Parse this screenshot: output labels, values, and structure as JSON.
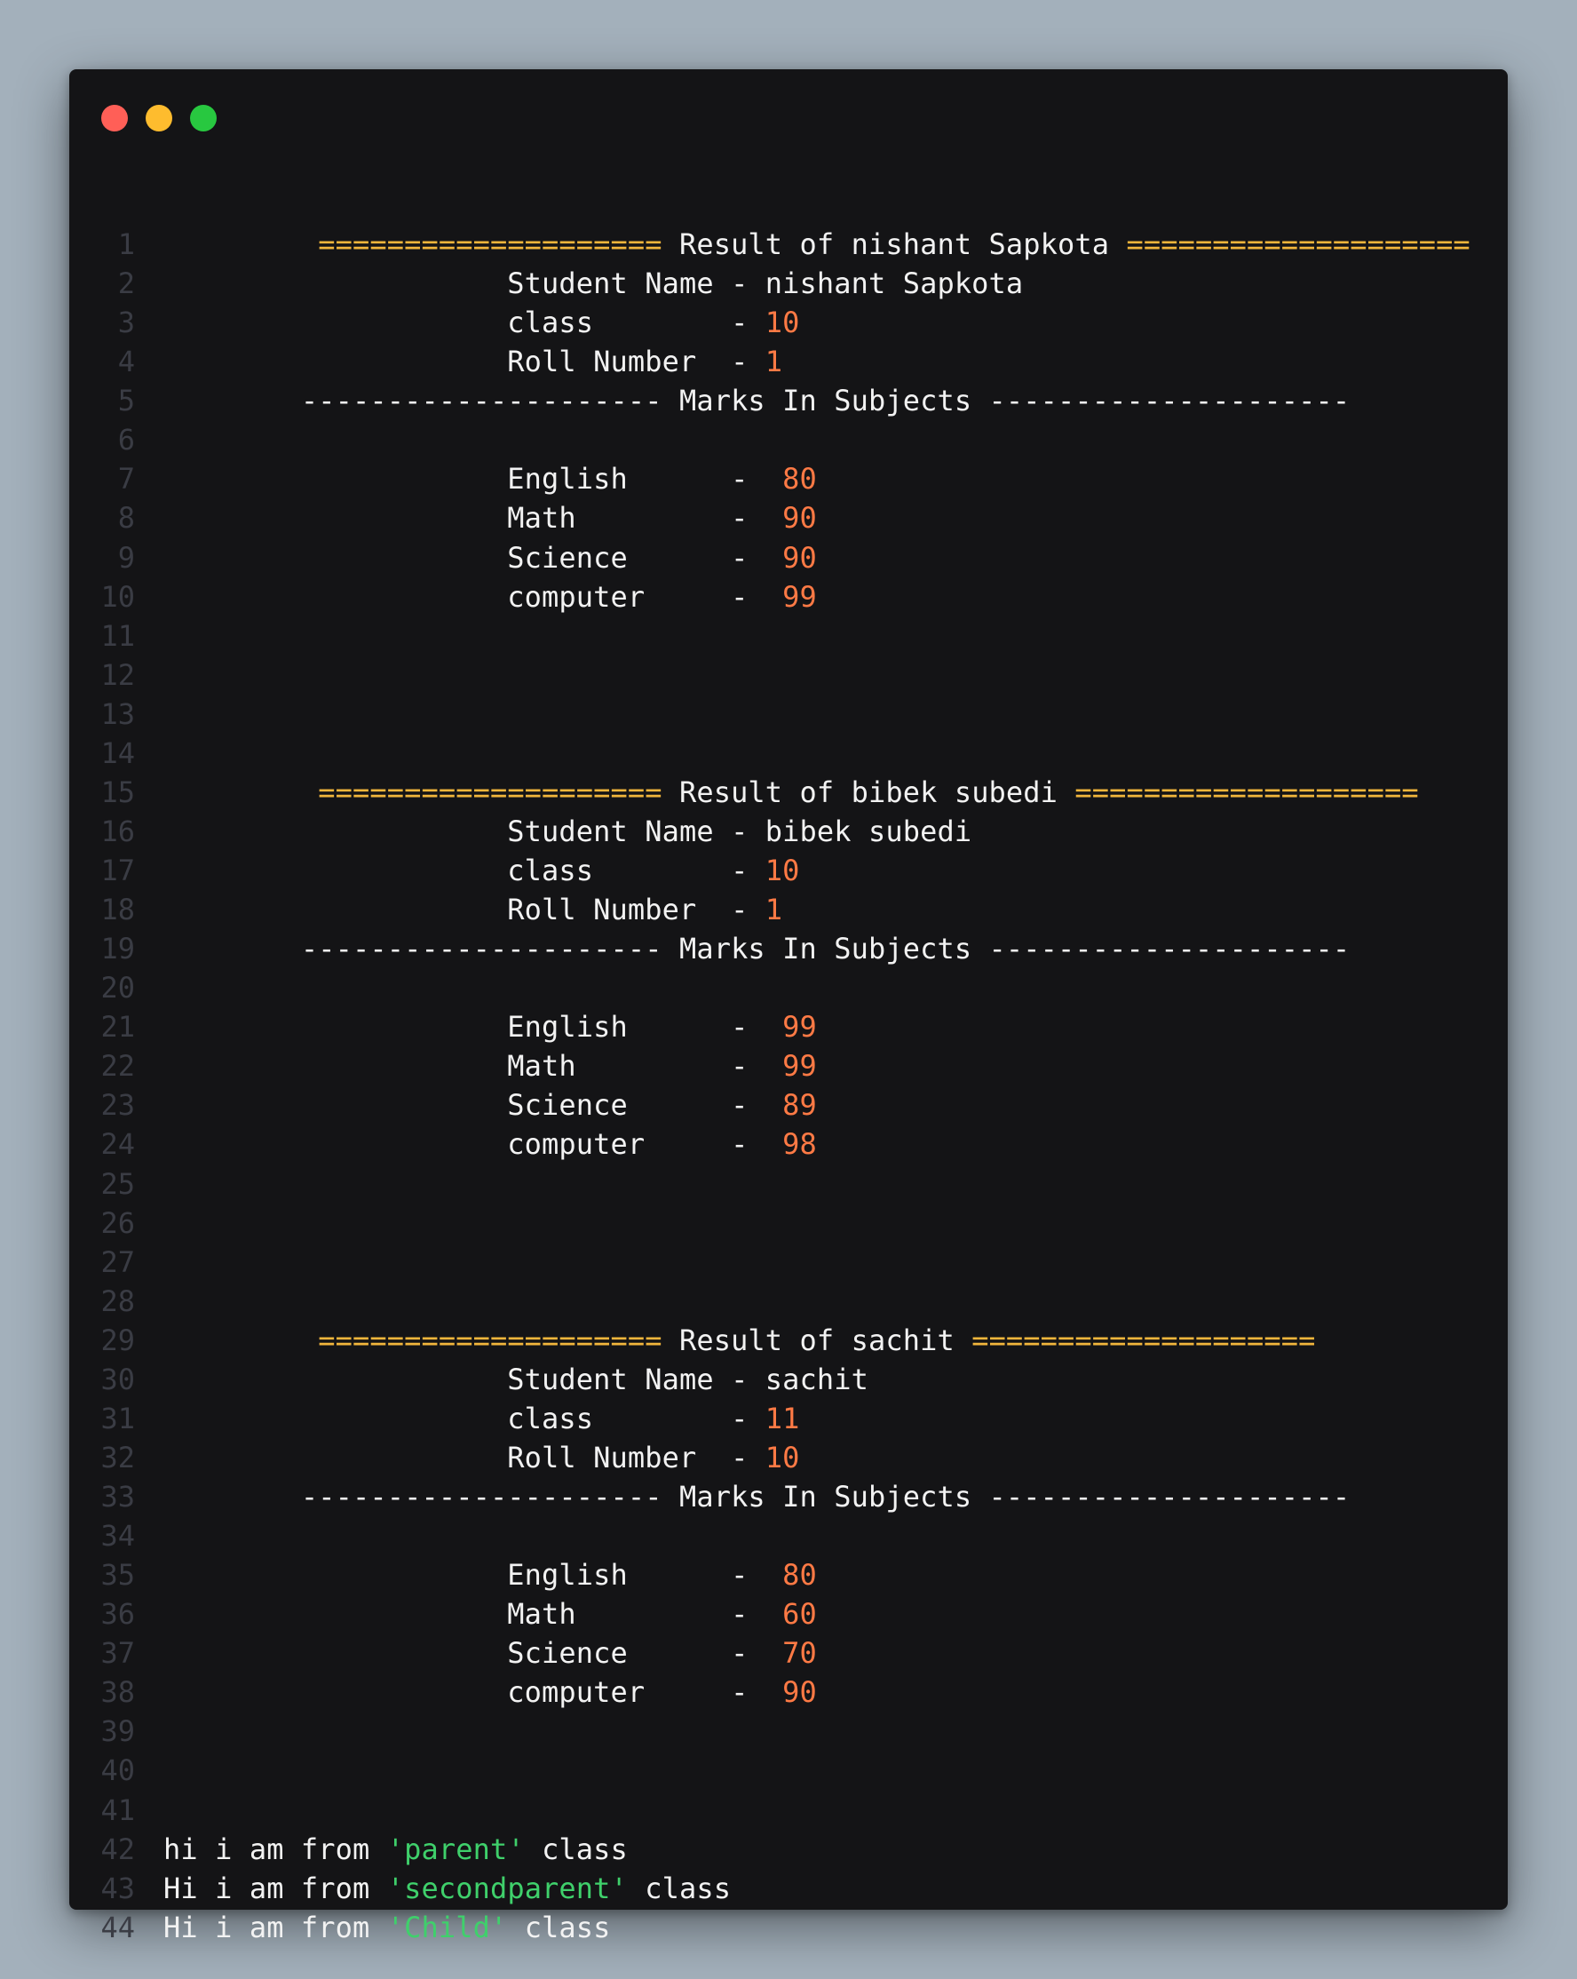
{
  "window": {
    "controls": [
      "close",
      "minimize",
      "maximize"
    ],
    "colors": {
      "background": "#141416",
      "text": "#f2f2f2",
      "number": "#ff7a45",
      "separator": "#f2b63c",
      "string": "#3fd06b",
      "line_number": "#3a3c44"
    }
  },
  "lines": [
    {
      "n": "1",
      "segs": [
        {
          "t": "         ",
          "c": ""
        },
        {
          "t": "====================",
          "c": "eq"
        },
        {
          "t": " Result of nishant Sapkota ",
          "c": ""
        },
        {
          "t": "====================",
          "c": "eq"
        }
      ]
    },
    {
      "n": "2",
      "segs": [
        {
          "t": "                    Student Name - nishant Sapkota",
          "c": ""
        }
      ]
    },
    {
      "n": "3",
      "segs": [
        {
          "t": "                    class        - ",
          "c": ""
        },
        {
          "t": "10",
          "c": "num"
        }
      ]
    },
    {
      "n": "4",
      "segs": [
        {
          "t": "                    Roll Number  - ",
          "c": ""
        },
        {
          "t": "1",
          "c": "num"
        }
      ]
    },
    {
      "n": "5",
      "segs": [
        {
          "t": "        --------------------- Marks In Subjects ---------------------",
          "c": ""
        }
      ]
    },
    {
      "n": "6",
      "segs": []
    },
    {
      "n": "7",
      "segs": [
        {
          "t": "                    English      -  ",
          "c": ""
        },
        {
          "t": "80",
          "c": "num"
        }
      ]
    },
    {
      "n": "8",
      "segs": [
        {
          "t": "                    Math         -  ",
          "c": ""
        },
        {
          "t": "90",
          "c": "num"
        }
      ]
    },
    {
      "n": "9",
      "segs": [
        {
          "t": "                    Science      -  ",
          "c": ""
        },
        {
          "t": "90",
          "c": "num"
        }
      ]
    },
    {
      "n": "10",
      "segs": [
        {
          "t": "                    computer     -  ",
          "c": ""
        },
        {
          "t": "99",
          "c": "num"
        }
      ]
    },
    {
      "n": "11",
      "segs": []
    },
    {
      "n": "12",
      "segs": []
    },
    {
      "n": "13",
      "segs": []
    },
    {
      "n": "14",
      "segs": []
    },
    {
      "n": "15",
      "segs": [
        {
          "t": "         ",
          "c": ""
        },
        {
          "t": "====================",
          "c": "eq"
        },
        {
          "t": " Result of bibek subedi ",
          "c": ""
        },
        {
          "t": "====================",
          "c": "eq"
        }
      ]
    },
    {
      "n": "16",
      "segs": [
        {
          "t": "                    Student Name - bibek subedi",
          "c": ""
        }
      ]
    },
    {
      "n": "17",
      "segs": [
        {
          "t": "                    class        - ",
          "c": ""
        },
        {
          "t": "10",
          "c": "num"
        }
      ]
    },
    {
      "n": "18",
      "segs": [
        {
          "t": "                    Roll Number  - ",
          "c": ""
        },
        {
          "t": "1",
          "c": "num"
        }
      ]
    },
    {
      "n": "19",
      "segs": [
        {
          "t": "        --------------------- Marks In Subjects ---------------------",
          "c": ""
        }
      ]
    },
    {
      "n": "20",
      "segs": []
    },
    {
      "n": "21",
      "segs": [
        {
          "t": "                    English      -  ",
          "c": ""
        },
        {
          "t": "99",
          "c": "num"
        }
      ]
    },
    {
      "n": "22",
      "segs": [
        {
          "t": "                    Math         -  ",
          "c": ""
        },
        {
          "t": "99",
          "c": "num"
        }
      ]
    },
    {
      "n": "23",
      "segs": [
        {
          "t": "                    Science      -  ",
          "c": ""
        },
        {
          "t": "89",
          "c": "num"
        }
      ]
    },
    {
      "n": "24",
      "segs": [
        {
          "t": "                    computer     -  ",
          "c": ""
        },
        {
          "t": "98",
          "c": "num"
        }
      ]
    },
    {
      "n": "25",
      "segs": []
    },
    {
      "n": "26",
      "segs": []
    },
    {
      "n": "27",
      "segs": []
    },
    {
      "n": "28",
      "segs": []
    },
    {
      "n": "29",
      "segs": [
        {
          "t": "         ",
          "c": ""
        },
        {
          "t": "====================",
          "c": "eq"
        },
        {
          "t": " Result of sachit ",
          "c": ""
        },
        {
          "t": "====================",
          "c": "eq"
        }
      ]
    },
    {
      "n": "30",
      "segs": [
        {
          "t": "                    Student Name - sachit",
          "c": ""
        }
      ]
    },
    {
      "n": "31",
      "segs": [
        {
          "t": "                    class        - ",
          "c": ""
        },
        {
          "t": "11",
          "c": "num"
        }
      ]
    },
    {
      "n": "32",
      "segs": [
        {
          "t": "                    Roll Number  - ",
          "c": ""
        },
        {
          "t": "10",
          "c": "num"
        }
      ]
    },
    {
      "n": "33",
      "segs": [
        {
          "t": "        --------------------- Marks In Subjects ---------------------",
          "c": ""
        }
      ]
    },
    {
      "n": "34",
      "segs": []
    },
    {
      "n": "35",
      "segs": [
        {
          "t": "                    English      -  ",
          "c": ""
        },
        {
          "t": "80",
          "c": "num"
        }
      ]
    },
    {
      "n": "36",
      "segs": [
        {
          "t": "                    Math         -  ",
          "c": ""
        },
        {
          "t": "60",
          "c": "num"
        }
      ]
    },
    {
      "n": "37",
      "segs": [
        {
          "t": "                    Science      -  ",
          "c": ""
        },
        {
          "t": "70",
          "c": "num"
        }
      ]
    },
    {
      "n": "38",
      "segs": [
        {
          "t": "                    computer     -  ",
          "c": ""
        },
        {
          "t": "90",
          "c": "num"
        }
      ]
    },
    {
      "n": "39",
      "segs": []
    },
    {
      "n": "40",
      "segs": []
    },
    {
      "n": "41",
      "segs": []
    },
    {
      "n": "42",
      "segs": [
        {
          "t": "hi i am from ",
          "c": ""
        },
        {
          "t": "'parent'",
          "c": "str"
        },
        {
          "t": " class",
          "c": ""
        }
      ]
    },
    {
      "n": "43",
      "segs": [
        {
          "t": "Hi i am from ",
          "c": ""
        },
        {
          "t": "'secondparent'",
          "c": "str"
        },
        {
          "t": " class",
          "c": ""
        }
      ]
    },
    {
      "n": "44",
      "segs": [
        {
          "t": "Hi i am from ",
          "c": ""
        },
        {
          "t": "'Child'",
          "c": "str"
        },
        {
          "t": " class",
          "c": ""
        }
      ]
    }
  ]
}
